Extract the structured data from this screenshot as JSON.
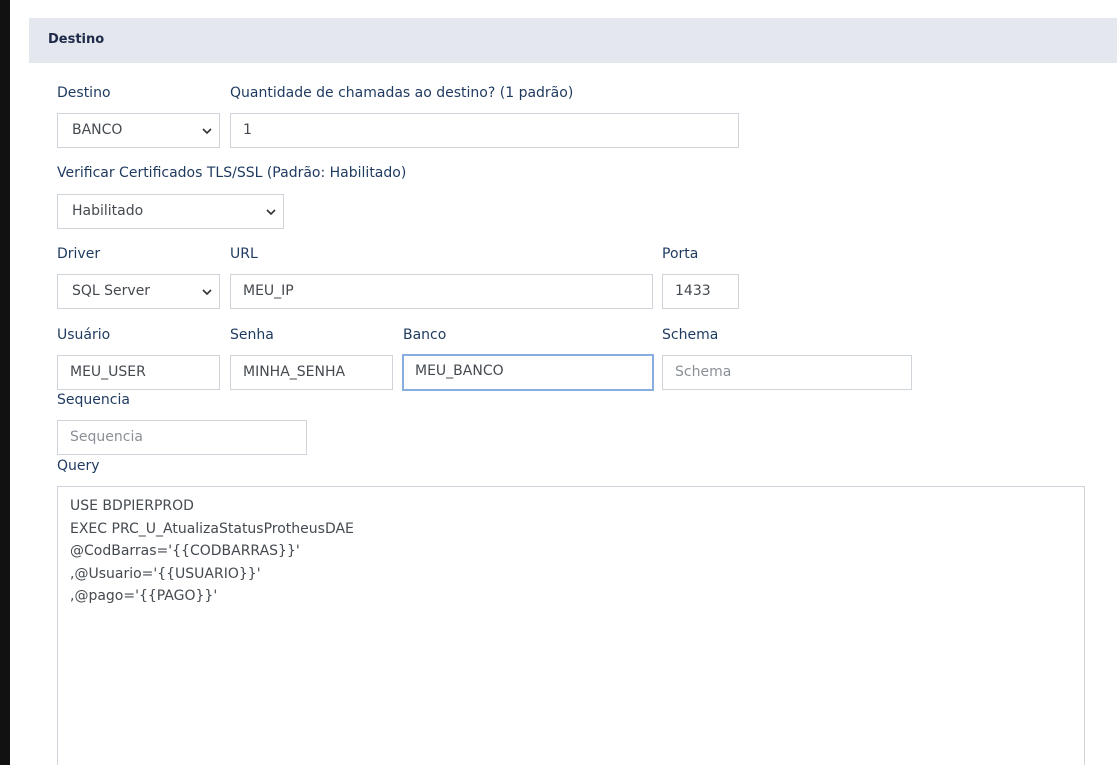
{
  "section": {
    "title": "Destino"
  },
  "destino": {
    "label": "Destino",
    "value": "BANCO"
  },
  "quantidade": {
    "label": "Quantidade de chamadas ao destino? (1 padrão)",
    "value": "1"
  },
  "tls": {
    "label": "Verificar Certificados TLS/SSL (Padrão: Habilitado)",
    "value": "Habilitado"
  },
  "driver": {
    "label": "Driver",
    "value": "SQL Server"
  },
  "url": {
    "label": "URL",
    "value": "MEU_IP"
  },
  "porta": {
    "label": "Porta",
    "value": "1433"
  },
  "usuario": {
    "label": "Usuário",
    "value": "MEU_USER"
  },
  "senha": {
    "label": "Senha",
    "value": "MINHA_SENHA"
  },
  "banco": {
    "label": "Banco",
    "value": "MEU_BANCO"
  },
  "schema": {
    "label": "Schema",
    "placeholder": "Schema"
  },
  "sequencia": {
    "label": "Sequencia",
    "placeholder": "Sequencia"
  },
  "query": {
    "label": "Query",
    "lines": [
      "USE BDPIERPROD",
      "EXEC PRC_U_AtualizaStatusProtheusDAE",
      "@CodBarras='{{CODBARRAS}}'",
      ",@Usuario='{{USUARIO}}'",
      ",@pago='{{PAGO}}'"
    ]
  },
  "icons": {
    "dropdown": "chevron-down-icon"
  }
}
